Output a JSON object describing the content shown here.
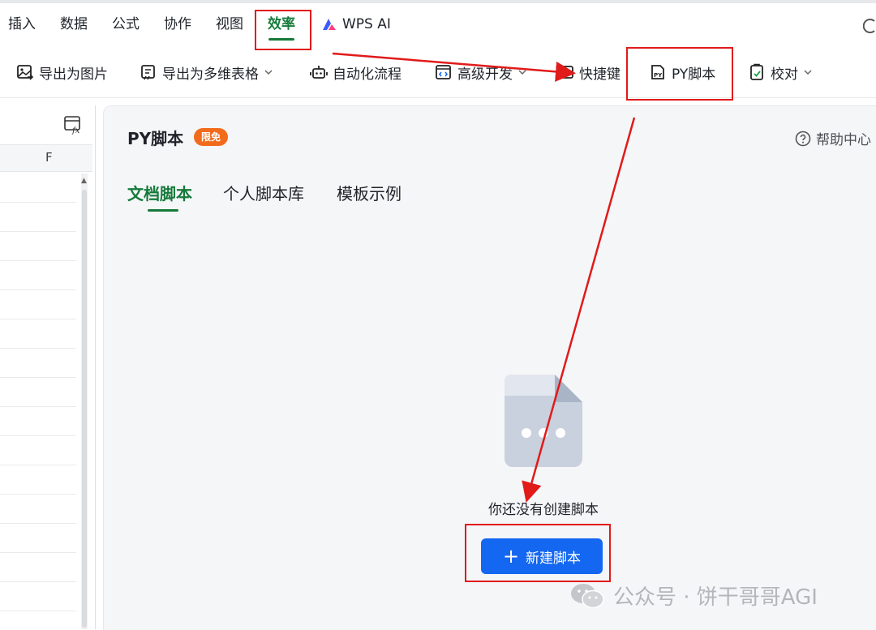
{
  "menu": {
    "tabs": [
      {
        "label": "插入"
      },
      {
        "label": "数据"
      },
      {
        "label": "公式"
      },
      {
        "label": "协作"
      },
      {
        "label": "视图"
      },
      {
        "label": "效率"
      },
      {
        "label": "WPS AI"
      }
    ],
    "active_tab": "效率"
  },
  "toolbar": {
    "items": [
      {
        "label": "导出为图片",
        "icon": "image-export-icon"
      },
      {
        "label": "导出为多维表格",
        "icon": "table-export-icon",
        "has_dropdown": true
      },
      {
        "label": "自动化流程",
        "icon": "robot-icon"
      },
      {
        "label": "高级开发",
        "icon": "code-window-icon",
        "has_dropdown": true
      },
      {
        "label": "快捷键",
        "icon": "keyboard-icon"
      },
      {
        "label": "PY脚本",
        "icon": "py-script-icon"
      },
      {
        "label": "校对",
        "icon": "proofread-icon",
        "has_dropdown": true
      }
    ]
  },
  "sheet": {
    "column_header": "F"
  },
  "panel": {
    "title": "PY脚本",
    "badge": "限免",
    "help_label": "帮助中心",
    "tabs": [
      {
        "label": "文档脚本"
      },
      {
        "label": "个人脚本库"
      },
      {
        "label": "模板示例"
      }
    ],
    "active_tab": "文档脚本",
    "empty_text": "你还没有创建脚本",
    "new_button_label": "新建脚本"
  },
  "watermark": {
    "text": "公众号 · 饼干哥哥AGI"
  },
  "colors": {
    "accent_green": "#157a3a",
    "primary_blue": "#1467f0",
    "badge_orange": "#f26b1d",
    "annotation_red": "#e11a1a"
  }
}
